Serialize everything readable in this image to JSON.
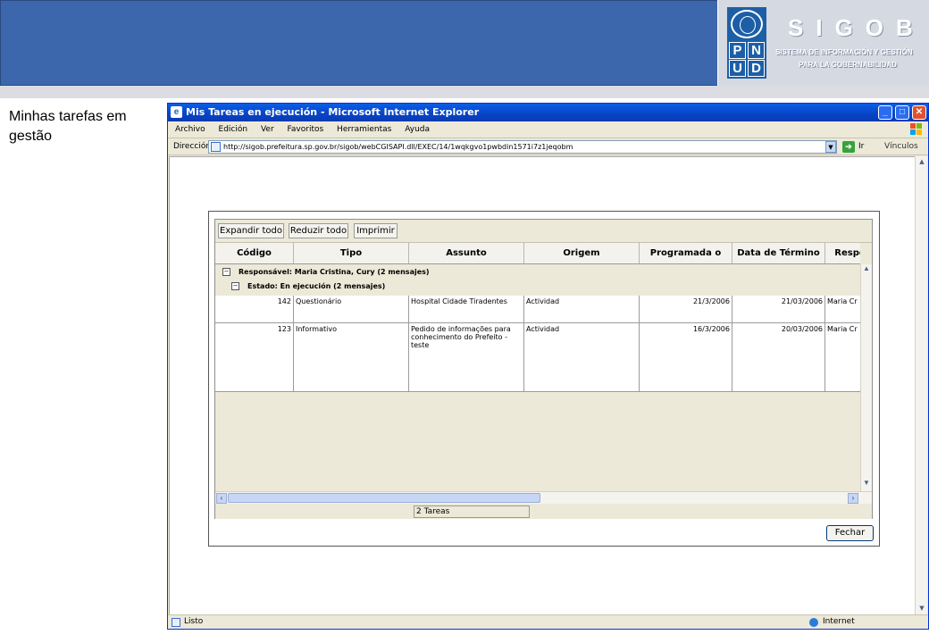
{
  "banner": {
    "brand_title": "SIGOB",
    "brand_subtitle_line1": "SISTEMA DE INFORMACIÓN Y GESTIÓN",
    "brand_subtitle_line2": "PARA LA GOBERNABILIDAD",
    "undp_letters": [
      "P",
      "N",
      "U",
      "D"
    ]
  },
  "caption": "Minhas tarefas em gestão",
  "browser": {
    "window_title": "Mis Tareas en ejecución - Microsoft Internet Explorer",
    "menu": [
      "Archivo",
      "Edición",
      "Ver",
      "Favoritos",
      "Herramientas",
      "Ayuda"
    ],
    "address_label": "Dirección",
    "address_url": "http://sigob.prefeitura.sp.gov.br/sigob/webCGISAPI.dll/EXEC/14/1wqkgvo1pwbdin1571i7z1jeqobm",
    "go_label": "Ir",
    "links_label": "Vínculos",
    "status_text": "Listo",
    "zone_text": "Internet"
  },
  "app": {
    "toolbar": {
      "expand_label": "Expandir todo",
      "collapse_label": "Reduzir todo",
      "print_label": "Imprimir"
    },
    "columns": [
      "Código",
      "Tipo",
      "Assunto",
      "Origem",
      "Programada o",
      "Data de Término",
      "Respor"
    ],
    "group_responsible": "Responsável: Maria Cristina, Cury  (2 mensajes)",
    "group_state": "Estado: En ejecución  (2 mensajes)",
    "rows": [
      {
        "codigo": "142",
        "tipo": "Questionário",
        "assunto": "Hospital Cidade Tiradentes",
        "origem": "Actividad",
        "programada": "21/3/2006",
        "termino": "21/03/2006",
        "responsavel": "Maria Cr"
      },
      {
        "codigo": "123",
        "tipo": "Informativo",
        "assunto": "Pedido de informações para conhecimento do Prefeito - teste",
        "origem": "Actividad",
        "programada": "16/3/2006",
        "termino": "20/03/2006",
        "responsavel": "Maria Cr"
      }
    ],
    "status_count": "2 Tareas",
    "close_label": "Fechar"
  }
}
